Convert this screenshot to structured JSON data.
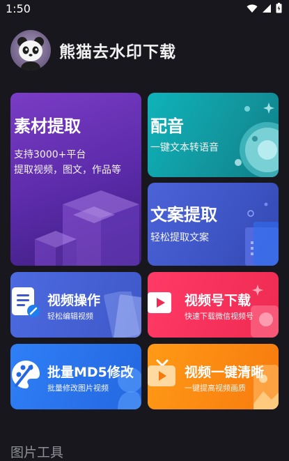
{
  "status": {
    "time": "1:50"
  },
  "app": {
    "title": "熊猫去水印下载"
  },
  "cards": {
    "material": {
      "title": "素材提取",
      "line1": "支持3000+平台",
      "line2": "提取视频，图文，作品等"
    },
    "dubbing": {
      "title": "配音",
      "subtitle": "一键文本转语音"
    },
    "copy": {
      "title": "文案提取",
      "subtitle": "轻松提取文案"
    },
    "video_ops": {
      "title": "视频操作",
      "subtitle": "轻松编辑视频"
    },
    "channel": {
      "title": "视频号下载",
      "subtitle": "快速下载微信视频号"
    },
    "md5": {
      "title": "批量MD5修改",
      "subtitle": "批量修改图片视频"
    },
    "clean": {
      "title": "视频一键清晰",
      "subtitle": "一键提高视频画质"
    }
  },
  "sections": {
    "image_tools": "图片工具"
  },
  "icons": {
    "status": [
      "wifi-icon",
      "signal-icon",
      "battery-icon"
    ],
    "cards": [
      "cube-illustration",
      "disc-icon",
      "document-icon",
      "video-play-icon",
      "palette-icon",
      "tv-icon"
    ]
  }
}
